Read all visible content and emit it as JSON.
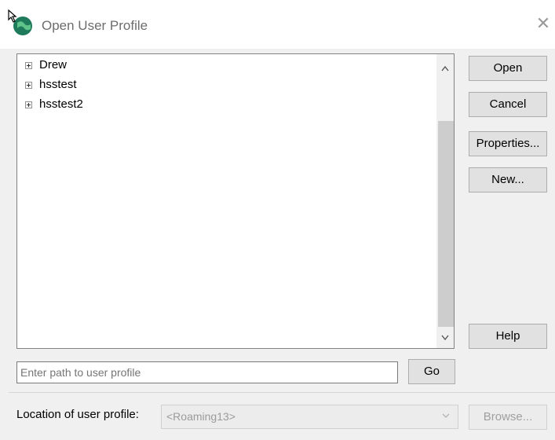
{
  "window": {
    "title": "Open User Profile",
    "icon": "globe-cursor-icon",
    "close_glyph": "✕"
  },
  "tree": {
    "items": [
      {
        "label": "Drew",
        "expander": "plus-box-icon"
      },
      {
        "label": "hsstest",
        "expander": "plus-box-icon"
      },
      {
        "label": "hsstest2",
        "expander": "plus-box-icon"
      }
    ],
    "scroll_up_glyph": "^",
    "scroll_down_glyph": "v"
  },
  "buttons": {
    "open": "Open",
    "cancel": "Cancel",
    "properties": "Properties...",
    "new": "New...",
    "help": "Help",
    "go": "Go",
    "browse": "Browse..."
  },
  "path_input": {
    "value": "",
    "placeholder": "Enter path to user profile"
  },
  "location": {
    "label": "Location of user profile:",
    "selected": "<Roaming13>",
    "disabled": true
  },
  "colors": {
    "dialog_bg": "#f0f0f0",
    "button_bg": "#e1e1e1",
    "button_border": "#adadad",
    "disabled_text": "#9b9b9b"
  }
}
